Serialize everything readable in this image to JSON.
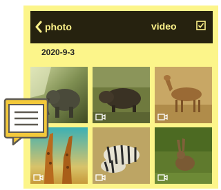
{
  "header": {
    "back_label": "photo",
    "video_tab_label": "video",
    "select_icon": "checkbox-icon"
  },
  "gallery": {
    "date": "2020-9-3",
    "items": [
      {
        "subject": "elephant",
        "media_icon": "video-icon"
      },
      {
        "subject": "boar",
        "media_icon": "video-icon"
      },
      {
        "subject": "deer",
        "media_icon": "video-icon"
      },
      {
        "subject": "giraffes",
        "media_icon": "video-icon"
      },
      {
        "subject": "zebras",
        "media_icon": "video-icon"
      },
      {
        "subject": "hare",
        "media_icon": "video-icon"
      }
    ]
  },
  "overlay": {
    "icon": "chat-bubble-icon"
  },
  "colors": {
    "screen_bg": "#fcf58a",
    "topbar_bg": "#26220f",
    "topbar_text": "#fdf28a",
    "chat_yellow": "#f3c93b"
  }
}
